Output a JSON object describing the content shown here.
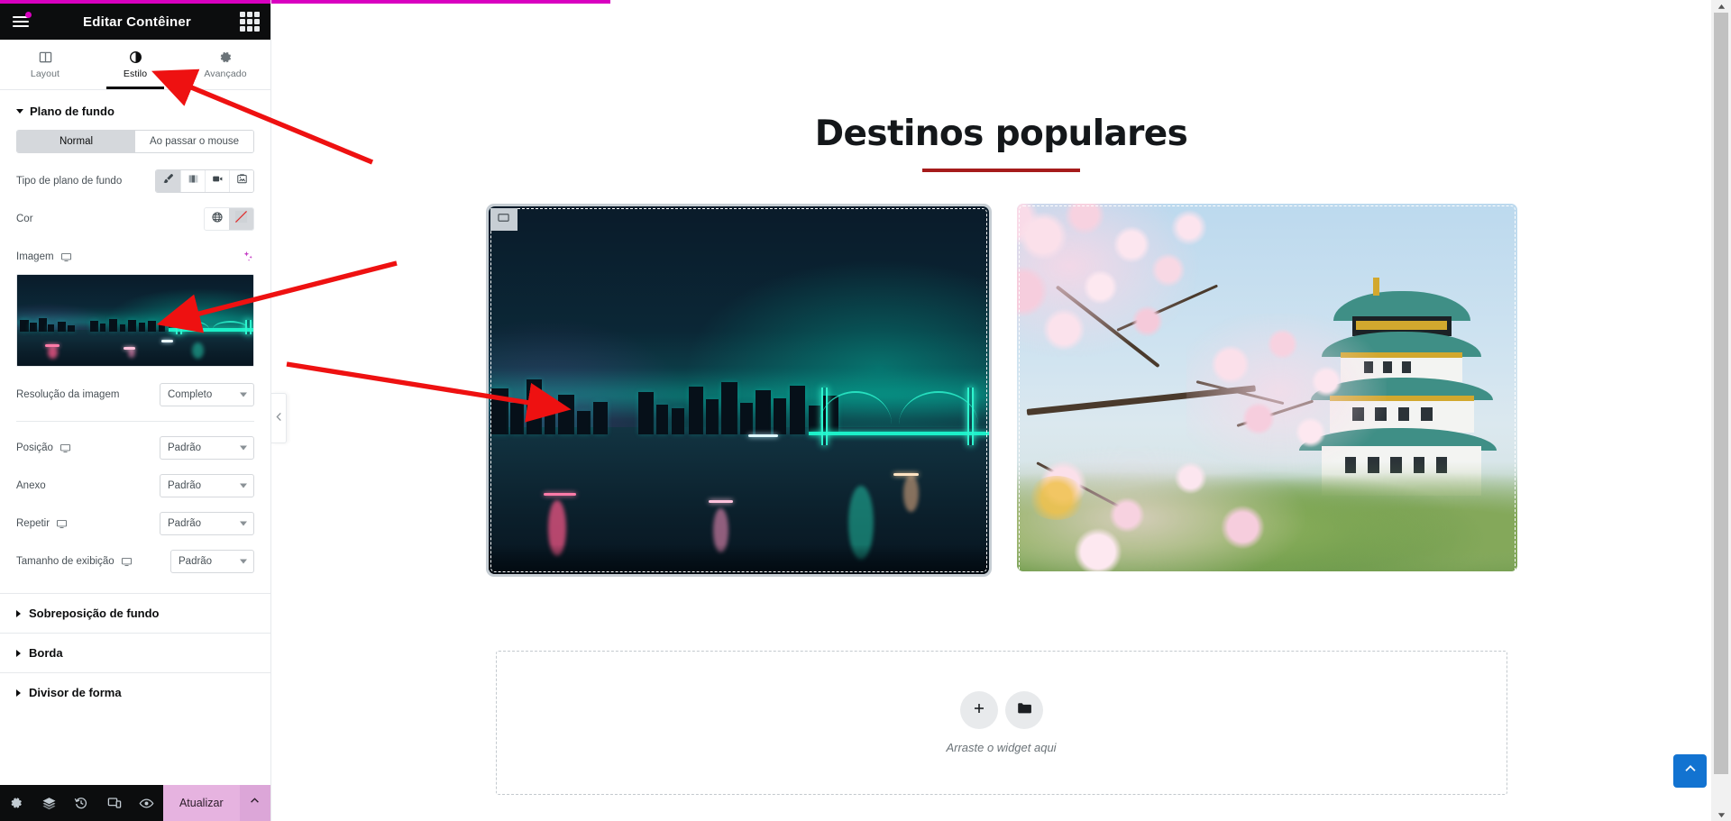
{
  "panel": {
    "header": {
      "title": "Editar Contêiner",
      "menu_icon": "hamburger-menu-icon",
      "grid_icon": "apps-grid-icon"
    },
    "tabs": [
      {
        "label": "Layout",
        "icon": "layout-columns-icon",
        "active": false
      },
      {
        "label": "Estilo",
        "icon": "contrast-circle-icon",
        "active": true
      },
      {
        "label": "Avançado",
        "icon": "gear-icon",
        "active": false
      }
    ],
    "background_section": {
      "title": "Plano de fundo",
      "expanded": true,
      "state_switcher": {
        "options": [
          "Normal",
          "Ao passar o mouse"
        ],
        "selected": "Normal"
      },
      "background_type": {
        "label": "Tipo de plano de fundo",
        "options": [
          "classic",
          "gradient",
          "video",
          "slideshow"
        ],
        "selected": "classic"
      },
      "color": {
        "label": "Cor",
        "global_icon": "globe-icon",
        "swatch": "no-color-swatch",
        "value": ""
      },
      "image": {
        "label": "Imagem",
        "device_icon": "desktop-icon",
        "ai_icon": "ai-sparkle-icon",
        "thumbnail_alt": "tokyo-rainbow-bridge-night"
      },
      "image_resolution": {
        "label": "Resolução da imagem",
        "value": "Completo"
      },
      "position": {
        "label": "Posição",
        "value": "Padrão",
        "device_icon": "desktop-icon"
      },
      "attachment": {
        "label": "Anexo",
        "value": "Padrão"
      },
      "repeat": {
        "label": "Repetir",
        "value": "Padrão",
        "device_icon": "desktop-icon"
      },
      "display_size": {
        "label": "Tamanho de exibição",
        "value": "Padrão",
        "device_icon": "desktop-icon"
      }
    },
    "collapsed_sections": [
      {
        "label": "Sobreposição de fundo"
      },
      {
        "label": "Borda"
      },
      {
        "label": "Divisor de forma"
      }
    ],
    "footer": {
      "icons": [
        "settings-gear-icon",
        "navigator-layers-icon",
        "history-clock-icon",
        "responsive-mode-icon",
        "preview-eye-icon"
      ],
      "update_label": "Atualizar",
      "update_caret_icon": "chevron-up-icon"
    },
    "collapse_arrow_icon": "chevron-left-icon"
  },
  "canvas": {
    "heading": "Destinos populares",
    "cards": [
      {
        "name": "tokyo-rainbow-bridge-card",
        "alt": "Tokyo Rainbow Bridge at night",
        "selected": true
      },
      {
        "name": "osaka-castle-sakura-card",
        "alt": "Osaka Castle with cherry blossoms",
        "selected": false
      }
    ],
    "dropzone": {
      "text": "Arraste o widget aqui",
      "add_icon": "plus-icon",
      "folder_icon": "folder-icon"
    },
    "scroll_top_icon": "chevron-up-icon",
    "container_handle_icon": "container-edit-icon"
  },
  "colors": {
    "accent_pink": "#d900c0",
    "panel_dark": "#0c0d0e",
    "update_button": "#e6b3e0",
    "heading_rule": "#a61b1b",
    "scroll_button": "#1273d1",
    "annotation_arrow": "#ee1111"
  }
}
